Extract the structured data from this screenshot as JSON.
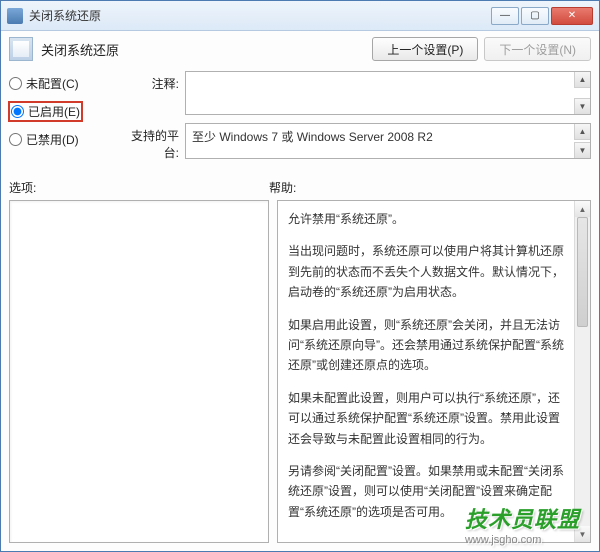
{
  "window": {
    "title": "关闭系统还原",
    "subtitle": "",
    "min": "—",
    "max": "▢",
    "close": "✕"
  },
  "header": {
    "title": "关闭系统还原",
    "prev_btn": "上一个设置(P)",
    "next_btn": "下一个设置(N)"
  },
  "radios": {
    "not_configured": "未配置(C)",
    "enabled": "已启用(E)",
    "disabled": "已禁用(D)"
  },
  "fields": {
    "comment_label": "注释:",
    "comment_value": "",
    "platform_label": "支持的平台:",
    "platform_value": "至少 Windows 7 或 Windows Server 2008 R2"
  },
  "sections": {
    "options": "选项:",
    "help": "帮助:"
  },
  "help": {
    "p1": "允许禁用“系统还原”。",
    "p2": "当出现问题时，系统还原可以使用户将其计算机还原到先前的状态而不丢失个人数据文件。默认情况下，启动卷的“系统还原”为启用状态。",
    "p3": "如果启用此设置，则“系统还原”会关闭，并且无法访问“系统还原向导”。还会禁用通过系统保护配置“系统还原”或创建还原点的选项。",
    "p4": "如果未配置此设置，则用户可以执行“系统还原”，还可以通过系统保护配置“系统还原”设置。禁用此设置还会导致与未配置此设置相同的行为。",
    "p5": "另请参阅“关闭配置”设置。如果禁用或未配置“关闭系统还原”设置，则可以使用“关闭配置”设置来确定配置“系统还原”的选项是否可用。"
  },
  "watermark": {
    "main": "技术员联盟",
    "sub": "www.jsgho.com"
  }
}
